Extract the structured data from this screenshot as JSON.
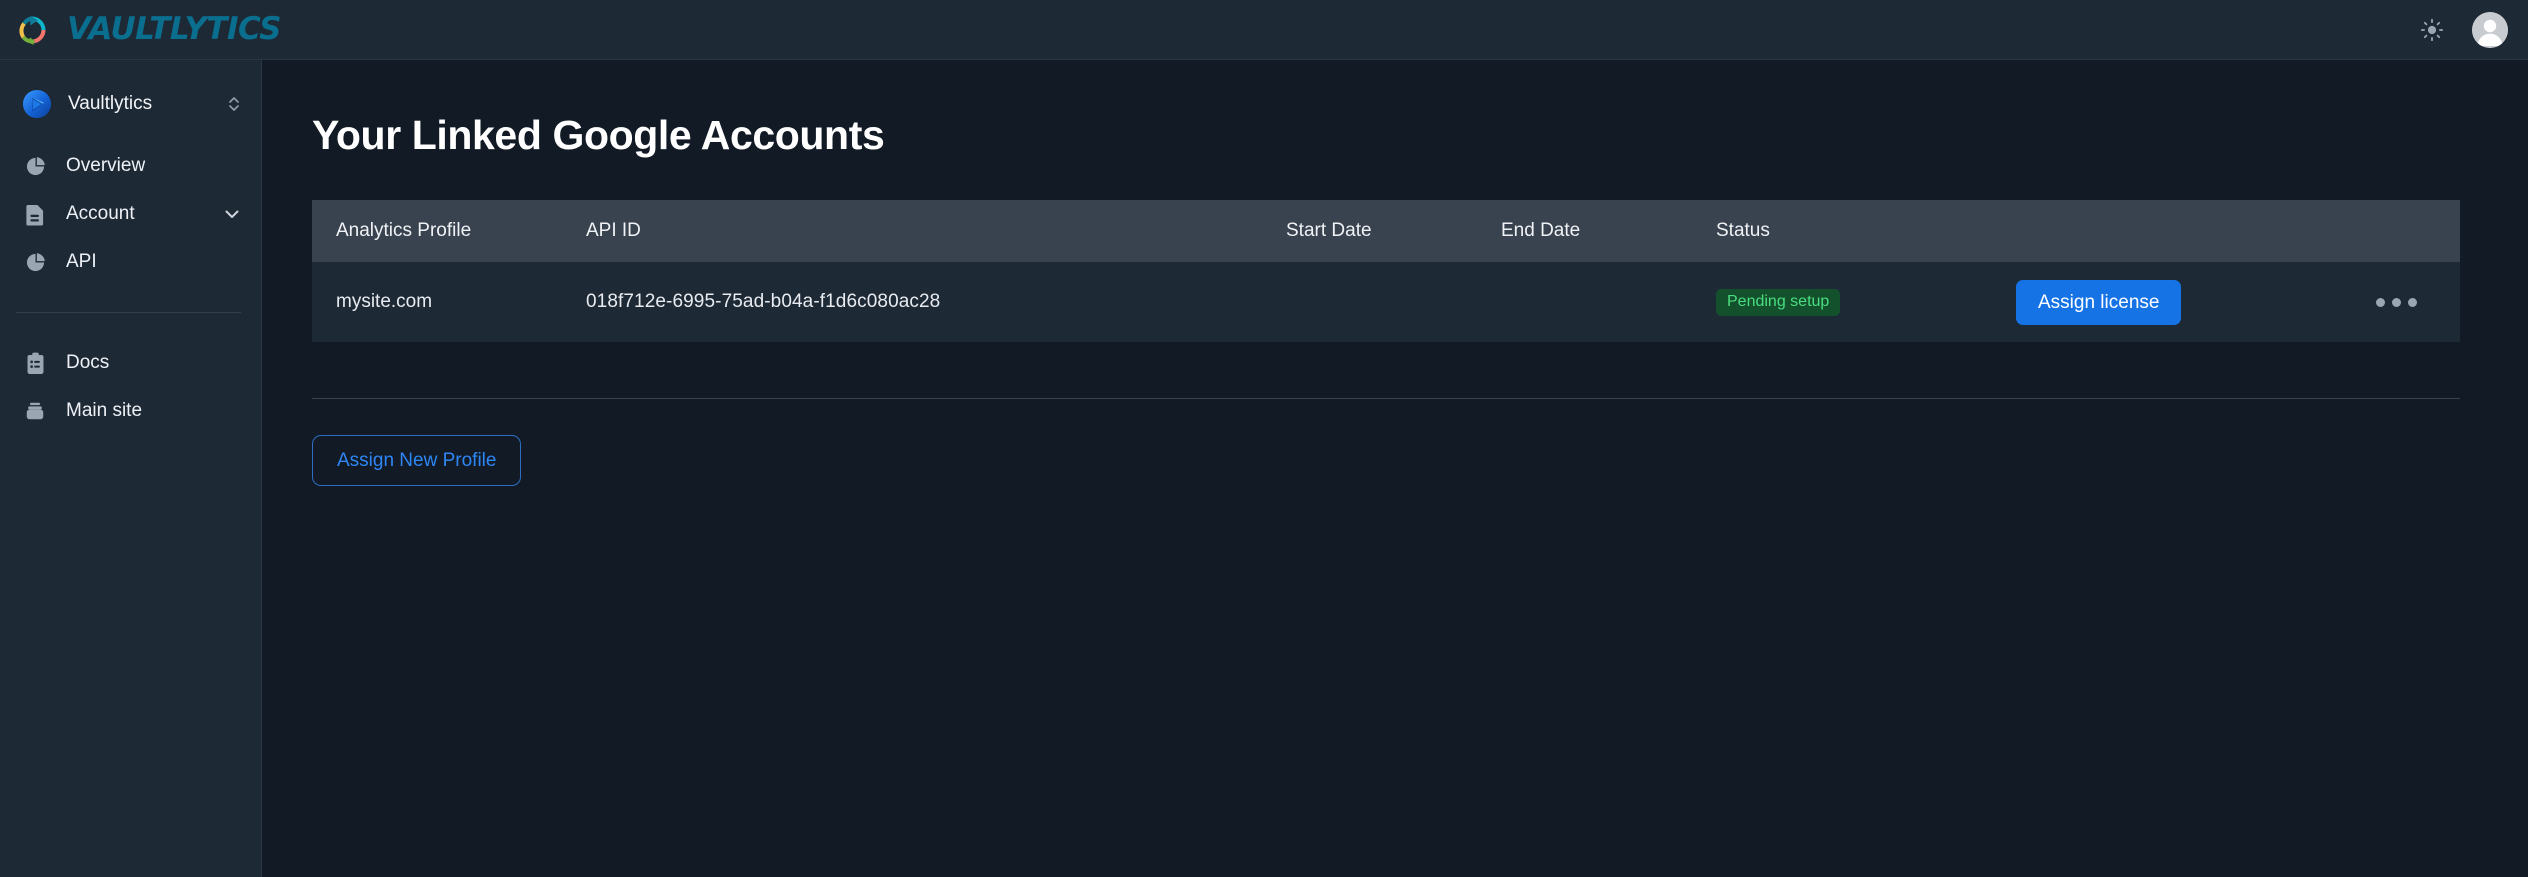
{
  "topbar": {
    "brand_name": "VAULTLYTICS",
    "brand_mark_icon": "circular-arrow-ring-logo",
    "theme_toggle_icon": "sun-icon",
    "avatar_icon": "user-avatar",
    "brand_color": "#0a6e8f",
    "background": "#1e2936"
  },
  "sidebar": {
    "workspace": {
      "name": "Vaultlytics",
      "icon": "workspace-play-icon",
      "chevron_icon": "chevron-up-down-icon"
    },
    "items": [
      {
        "label": "Overview",
        "icon": "pie-chart-icon",
        "has_caret": false
      },
      {
        "label": "Account",
        "icon": "document-icon",
        "has_caret": true,
        "caret_icon": "chevron-down-icon"
      },
      {
        "label": "API",
        "icon": "pie-chart-icon",
        "has_caret": false
      }
    ],
    "secondary_items": [
      {
        "label": "Docs",
        "icon": "clipboard-list-icon"
      },
      {
        "label": "Main site",
        "icon": "archive-box-icon"
      }
    ]
  },
  "main": {
    "page_title": "Your Linked Google Accounts",
    "table": {
      "columns": [
        "Analytics Profile",
        "API ID",
        "Start Date",
        "End Date",
        "Status",
        "",
        ""
      ],
      "rows": [
        {
          "analytics_profile": "mysite.com",
          "api_id": "018f712e-6995-75ad-b04a-f1d6c080ac28",
          "start_date": "",
          "end_date": "",
          "status": "Pending setup",
          "status_color": "#4ade80",
          "status_background": "#13502c",
          "action_label": "Assign license",
          "more_icon": "ellipsis-horizontal-icon"
        }
      ]
    },
    "assign_new_profile_label": "Assign New Profile",
    "accent_color": "#1673e6"
  }
}
